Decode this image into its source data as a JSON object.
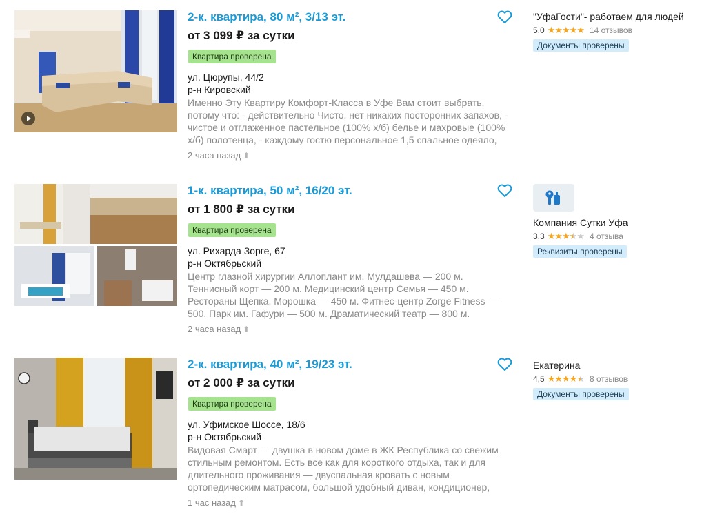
{
  "listings": [
    {
      "title": "2-к. квартира, 80 м², 3/13 эт.",
      "price": "от 3 099 ₽ за сутки",
      "verified": "Квартира проверена",
      "street": "ул. Цюрупы, 44/2",
      "district": "р-н Кировский",
      "desc": [
        "Именно Эту Квартиру Комфорт-Класса в Уфе Вам стоит выбрать,",
        "потому что: - действительно Чисто, нет никаких посторонних запахов, -",
        "чистое и отглаженное пастельное (100% х/б) белье и махровые (100%",
        "х/б) полотенца, - каждому гостю персональное 1,5 спальное одеяло,"
      ],
      "time": "2 часа назад",
      "owner": {
        "name": "\"УфаГости\"- работаем для людей",
        "rating": "5,0",
        "rating_value": 5.0,
        "reviews": "14 отзывов",
        "badge": "Документы проверены"
      }
    },
    {
      "title": "1-к. квартира, 50 м², 16/20 эт.",
      "price": "от 1 800 ₽ за сутки",
      "verified": "Квартира проверена",
      "street": "ул. Рихарда Зорге, 67",
      "district": "р-н Октябрьский",
      "desc": [
        "Центр глазной хирургии Аллоплант им. Мулдашева — 200 м.",
        "Теннисный корт — 200 м. Медицинский центр Семья — 450 м.",
        "Рестораны Щепка, Морошка — 450 м. Фитнес-центр Zorge Fitness —",
        "500. Парк им. Гафури — 500 м. Драматический театр — 800 м."
      ],
      "time": "2 часа назад",
      "owner": {
        "name": "Компания Сутки Уфа",
        "rating": "3,3",
        "rating_value": 3.3,
        "reviews": "4 отзыва",
        "badge": "Реквизиты проверены"
      }
    },
    {
      "title": "2-к. квартира, 40 м², 19/23 эт.",
      "price": "от 2 000 ₽ за сутки",
      "verified": "Квартира проверена",
      "street": "ул. Уфимское Шоссе, 18/6",
      "district": "р-н Октябрьский",
      "desc": [
        "Видовая Смарт — двушка в новом доме в ЖК Республика со свежим",
        "стильным ремонтом. Есть все как для короткого отдыха, так и для",
        "длительного проживания — двуспальная кровать с новым",
        "ортопедическим матрасом, большой удобный диван, кондиционер,"
      ],
      "time": "1 час назад",
      "owner": {
        "name": "Екатерина",
        "rating": "4,5",
        "rating_value": 4.5,
        "reviews": "8 отзывов",
        "badge": "Документы проверены"
      }
    }
  ],
  "colors": {
    "title": "#1a9bd7",
    "verified_bg": "#a6e38f",
    "owner_badge_bg": "#d3ecfb",
    "star": "#f4a623",
    "muted": "#8a8a8a"
  }
}
